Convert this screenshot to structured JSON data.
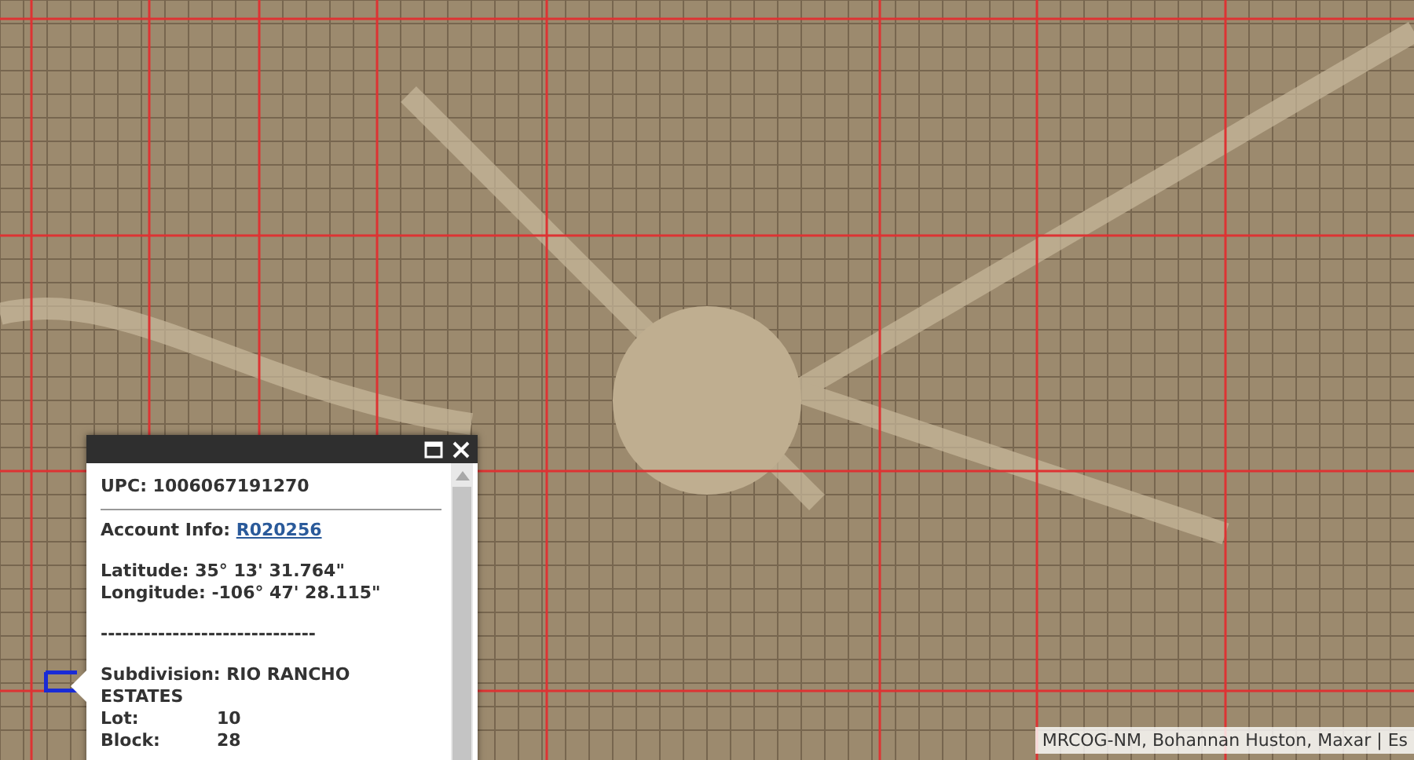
{
  "popup": {
    "upc": {
      "label": "UPC:",
      "value": "1006067191270"
    },
    "account": {
      "label": "Account Info:",
      "link": "R020256"
    },
    "latitude": {
      "label": "Latitude:",
      "value": "35° 13' 31.764\""
    },
    "longitude": {
      "label": "Longitude:",
      "value": "-106° 47' 28.115\""
    },
    "separator": "------------------------------",
    "subdivision": {
      "label": "Subdivision:",
      "value": "RIO RANCHO ESTATES"
    },
    "fields": [
      {
        "label": "Lot:",
        "value": "10"
      },
      {
        "label": "Block:",
        "value": "28"
      }
    ]
  },
  "attribution": "MRCOG-NM, Bohannan Huston, Maxar | Es"
}
